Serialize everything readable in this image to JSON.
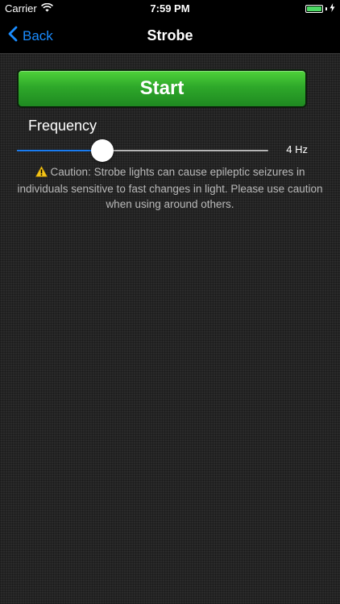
{
  "status_bar": {
    "carrier": "Carrier",
    "time": "7:59 PM",
    "battery_level": 1.0,
    "icons": [
      "wifi-icon",
      "battery-icon",
      "charging-bolt-icon"
    ]
  },
  "nav": {
    "back_label": "Back",
    "title": "Strobe",
    "back_icon": "chevron-left-icon"
  },
  "start_button": {
    "label": "Start"
  },
  "frequency": {
    "label": "Frequency",
    "value_text": "4 Hz",
    "slider_fraction": 0.34
  },
  "caution": {
    "icon": "warning-icon",
    "text": "Caution: Strobe lights can cause epileptic seizures in individuals sensitive to fast changes in light.  Please use caution when using around others."
  },
  "colors": {
    "accent": "#1a8cff",
    "start_green": "#2ea82a",
    "slider_fill": "#1a7cf0",
    "background": "#2a2a2a"
  }
}
